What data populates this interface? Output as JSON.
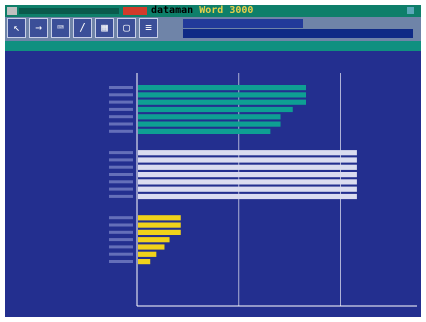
{
  "app": {
    "title_word_1": "dataman",
    "title_word_2": "Word",
    "title_word_3": "3000",
    "colors": {
      "desktop": "#232f8f",
      "titlebar": "#0e7f6a",
      "toolbar": "#6f84a8",
      "accent_red": "#d23b2a"
    }
  },
  "toolbar": {
    "buttons": [
      {
        "icon": "cursor-icon"
      },
      {
        "icon": "arrow-icon"
      },
      {
        "icon": "edit-icon"
      },
      {
        "icon": "pencil-icon"
      },
      {
        "icon": "grid-icon"
      },
      {
        "icon": "select-icon"
      },
      {
        "icon": "options-icon"
      }
    ]
  },
  "chart_data": {
    "type": "bar",
    "orientation": "horizontal",
    "groups": [
      {
        "name": "1 ----",
        "color": "#0e9f93",
        "values": [
          1650,
          1650,
          1650,
          1520,
          1400,
          1400,
          1300
        ]
      },
      {
        "name": "2 ----",
        "color": "#dadcf0",
        "values": [
          2150,
          2150,
          2150,
          2150,
          2150,
          2150,
          2150
        ]
      },
      {
        "name": "3 ------ 1",
        "color": "#f0d21a",
        "values": [
          420,
          420,
          420,
          310,
          260,
          180,
          120
        ]
      }
    ],
    "xlim": [
      0,
      2750
    ],
    "grid": true,
    "colors": {
      "gridline": "#ffffff",
      "axis": "#ffffff"
    }
  }
}
